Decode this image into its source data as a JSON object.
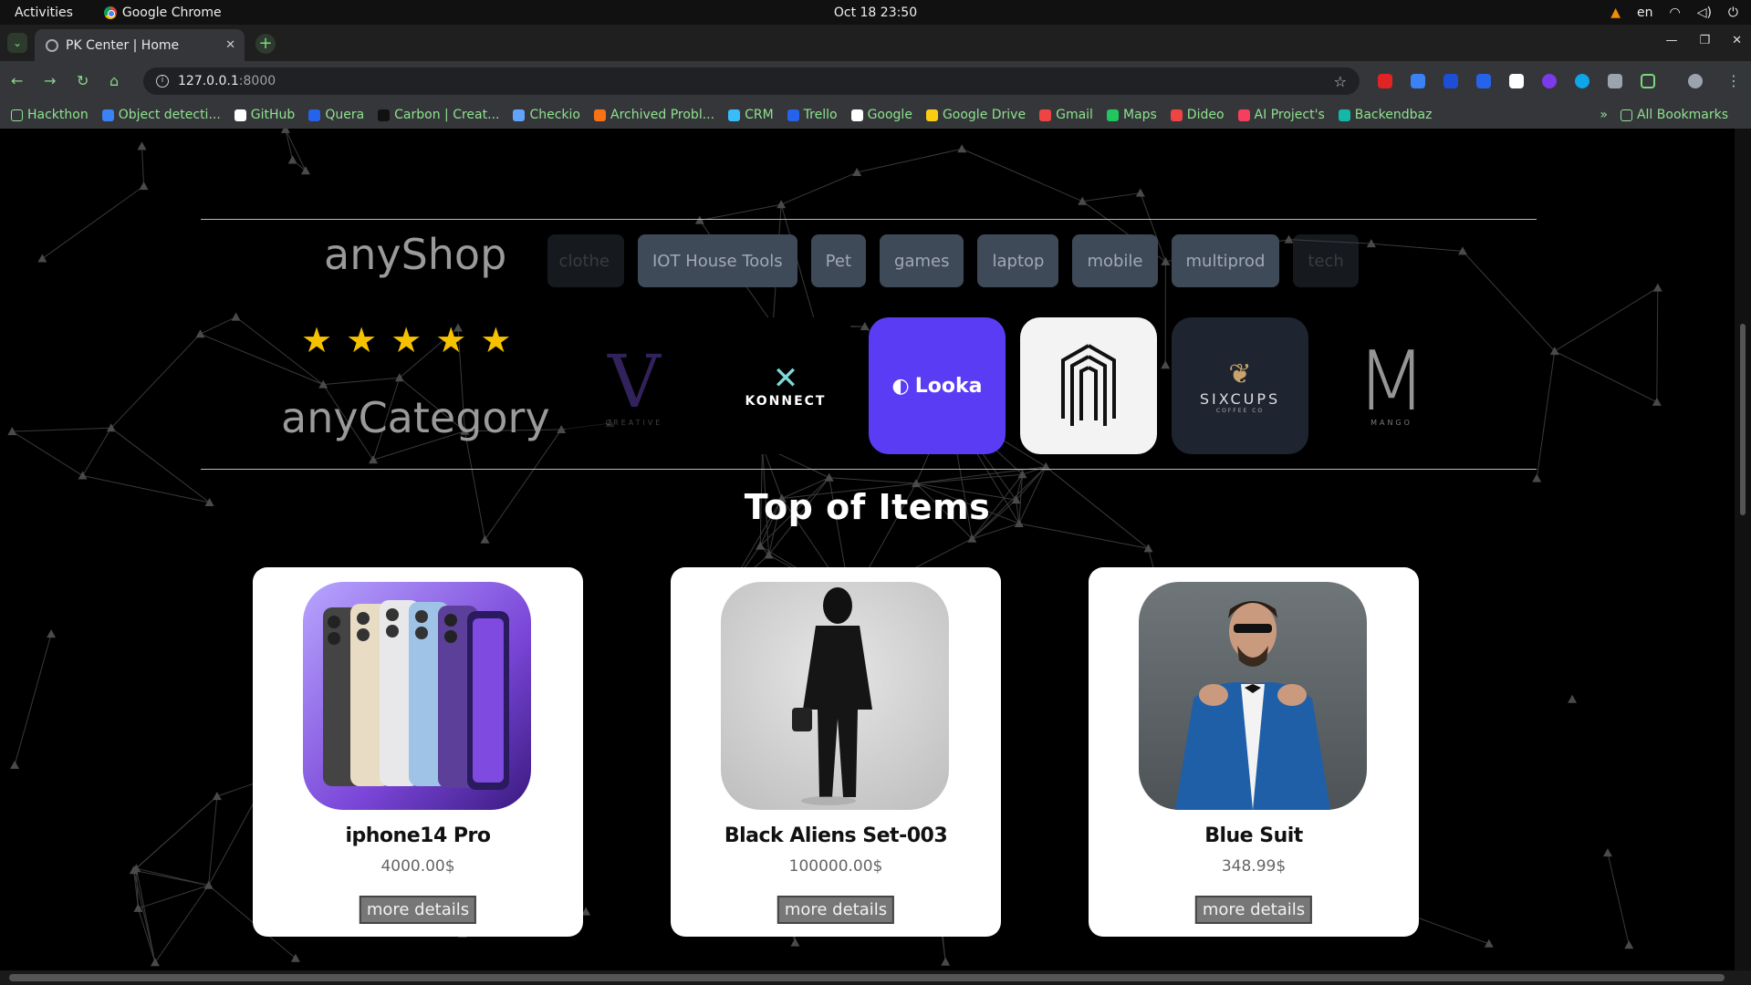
{
  "system_bar": {
    "activities": "Activities",
    "app_name": "Google Chrome",
    "clock": "Oct 18  23:50",
    "language": "en"
  },
  "browser": {
    "tab_title": "PK Center | Home",
    "url_host": "127.0.0.1",
    "url_port": ":8000",
    "bookmarks": [
      {
        "label": "Hackthon",
        "color": "#8ee28e"
      },
      {
        "label": "Object detecti...",
        "color": "#3b82f6"
      },
      {
        "label": "GitHub",
        "color": "#ffffff"
      },
      {
        "label": "Quera",
        "color": "#2563eb"
      },
      {
        "label": "Carbon | Creat...",
        "color": "#111111"
      },
      {
        "label": "Checkio",
        "color": "#60a5fa"
      },
      {
        "label": "Archived Probl...",
        "color": "#f97316"
      },
      {
        "label": "CRM",
        "color": "#38bdf8"
      },
      {
        "label": "Trello",
        "color": "#2563eb"
      },
      {
        "label": "Google",
        "color": "#ffffff"
      },
      {
        "label": "Google Drive",
        "color": "#facc15"
      },
      {
        "label": "Gmail",
        "color": "#ef4444"
      },
      {
        "label": "Maps",
        "color": "#22c55e"
      },
      {
        "label": "Dideo",
        "color": "#ef4444"
      },
      {
        "label": "AI Project's",
        "color": "#f43f5e"
      },
      {
        "label": "Backendbaz",
        "color": "#14b8a6"
      }
    ],
    "all_bookmarks": "All Bookmarks"
  },
  "page": {
    "brand_top": "anyShop",
    "brand_bottom": "anyCategory",
    "stars_count": 5,
    "categories": [
      "clothe",
      "IOT House Tools",
      "Pet",
      "games",
      "laptop",
      "mobile",
      "multiprod",
      "tech"
    ],
    "logos": [
      "V",
      "KONNECT",
      "Looka",
      "",
      "SIXCUPS",
      "M"
    ],
    "logo_sub": {
      "creative": "CREATIVE",
      "sixcups": "COFFEE CO",
      "mango": "MANGO"
    },
    "section_title": "Top of Items",
    "products": [
      {
        "name": "iphone14 Pro",
        "price": "4000.00$",
        "button": "more details"
      },
      {
        "name": "Black Aliens Set-003",
        "price": "100000.00$",
        "button": "more details"
      },
      {
        "name": "Blue Suit",
        "price": "348.99$",
        "button": "more details"
      }
    ]
  }
}
